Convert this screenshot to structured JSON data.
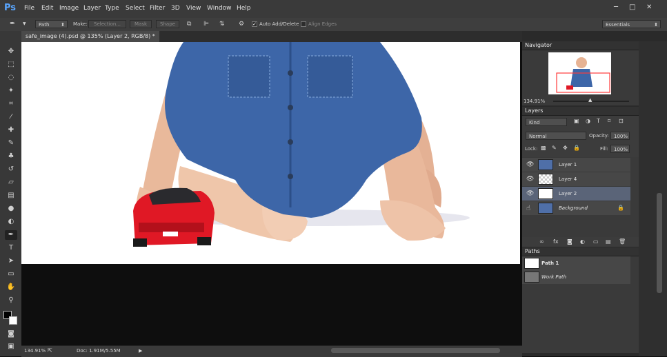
{
  "app": {
    "logo": "Ps"
  },
  "menu": [
    "File",
    "Edit",
    "Image",
    "Layer",
    "Type",
    "Select",
    "Filter",
    "3D",
    "View",
    "Window",
    "Help"
  ],
  "window_controls": {
    "minimize": "─",
    "maximize": "□",
    "close": "✕"
  },
  "options": {
    "mode": "Path",
    "make_label": "Make:",
    "selection_btn": "Selection...",
    "mask_btn": "Mask",
    "shape_btn": "Shape",
    "auto_add_delete": "Auto Add/Delete",
    "align_edges": "Align Edges",
    "workspace": "Essentials"
  },
  "document": {
    "tab_title": "safe_image (4).psd @ 135% (Layer 2, RGB/8) *",
    "zoom": "134.91%",
    "doc_info": "Doc: 1.91M/5.55M"
  },
  "navigator": {
    "title": "Navigator",
    "zoom": "134.91%"
  },
  "layers_panel": {
    "title": "Layers",
    "kind": "Kind",
    "blend_mode": "Normal",
    "opacity_label": "Opacity:",
    "opacity": "100%",
    "lock_label": "Lock:",
    "fill_label": "Fill:",
    "fill": "100%",
    "layers": [
      {
        "name": "Layer 1",
        "thumb": "photo"
      },
      {
        "name": "Layer 4",
        "thumb": "transparent"
      },
      {
        "name": "Layer 2",
        "thumb": "white",
        "selected": true
      },
      {
        "name": "Background",
        "thumb": "photo",
        "locked": true
      }
    ]
  },
  "paths_panel": {
    "title": "Paths",
    "paths": [
      {
        "name": "Path 1"
      },
      {
        "name": "Work Path"
      }
    ]
  },
  "colors": {
    "accent": "#59a6ff",
    "denim": "#3d66a8",
    "car_red": "#e01825",
    "selected_layer": "#5a6478"
  }
}
